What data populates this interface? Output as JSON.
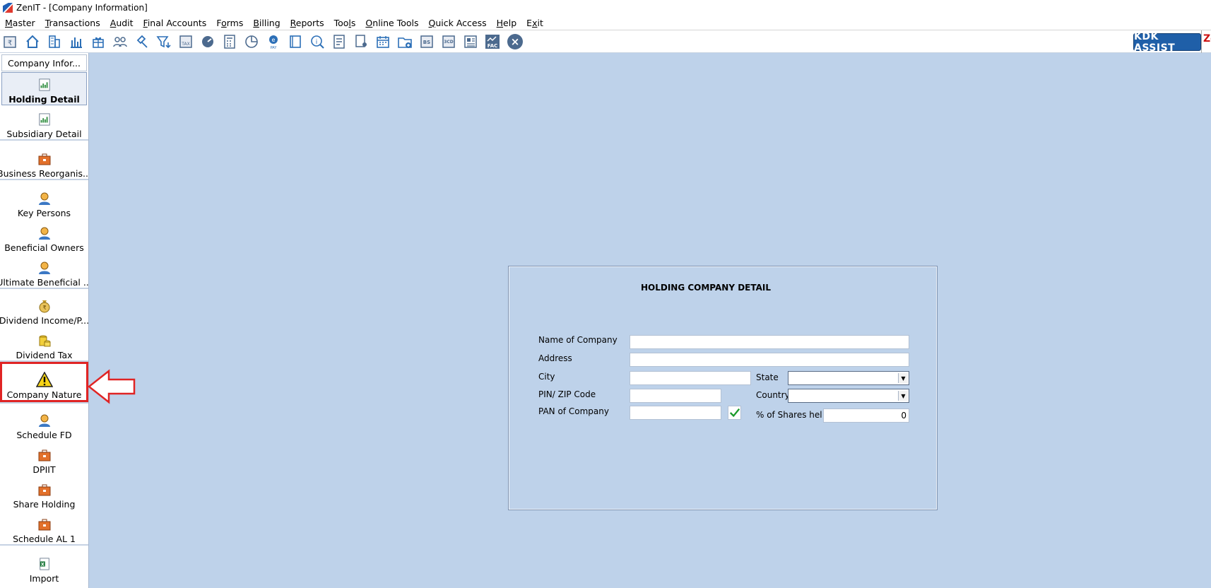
{
  "window": {
    "title": "ZenIT - [Company Information]"
  },
  "menu": {
    "items": [
      {
        "label": "Master",
        "mnemonic": "M",
        "rest": "aster"
      },
      {
        "label": "Transactions",
        "mnemonic": "T",
        "rest": "ransactions"
      },
      {
        "label": "Audit",
        "mnemonic": "A",
        "rest": "udit"
      },
      {
        "label": "Final Accounts",
        "mnemonic": "F",
        "rest": "inal Accounts"
      },
      {
        "label": "Forms",
        "mnemonic": "o",
        "pre": "F",
        "rest": "rms"
      },
      {
        "label": "Billing",
        "mnemonic": "B",
        "rest": "illing"
      },
      {
        "label": "Reports",
        "mnemonic": "R",
        "rest": "eports"
      },
      {
        "label": "Tools",
        "mnemonic": "l",
        "pre": "Too",
        "rest": "s"
      },
      {
        "label": "Online Tools",
        "mnemonic": "O",
        "rest": "nline Tools"
      },
      {
        "label": "Quick Access",
        "mnemonic": "Q",
        "rest": "uick Access"
      },
      {
        "label": "Help",
        "mnemonic": "H",
        "rest": "elp"
      },
      {
        "label": "Exit",
        "mnemonic": "x",
        "pre": "E",
        "rest": "it"
      }
    ]
  },
  "toolbar": {
    "icons": [
      "rupee-book-icon",
      "home-icon",
      "building-icon",
      "bar-chart-icon",
      "gift-icon",
      "group-icon",
      "gavel-icon",
      "filter-icon",
      "tax-calculator-icon",
      "speedometer-icon",
      "calculator-icon",
      "pie-chart-icon",
      "epay-icon",
      "ledger-book-icon",
      "info-search-icon",
      "report-sheet-icon",
      "user-document-icon",
      "calendar-icon",
      "folder-add-icon",
      "bs-icon",
      "3cd-icon",
      "newspaper-icon",
      "fac-icon"
    ],
    "kdk_assist_label": "KDK ASSIST",
    "edge_text": "Ze"
  },
  "sidebar": {
    "header": "Company Infor...",
    "items": [
      {
        "label": "Holding Detail",
        "icon": "report-icon"
      },
      {
        "label": "Subsidiary Detail",
        "icon": "report-icon"
      },
      {
        "label": "Business Reorganis...",
        "icon": "briefcase-icon"
      },
      {
        "label": "Key Persons",
        "icon": "person-icon"
      },
      {
        "label": "Beneficial Owners",
        "icon": "person-icon"
      },
      {
        "label": "Ultimate Beneficial ...",
        "icon": "person-icon"
      },
      {
        "label": "Dividend Income/P...",
        "icon": "money-bag-icon"
      },
      {
        "label": "Dividend Tax",
        "icon": "coins-icon"
      },
      {
        "label": "Company Nature",
        "icon": "warning-icon"
      },
      {
        "label": "Schedule FD",
        "icon": "person-icon"
      },
      {
        "label": "DPIIT",
        "icon": "briefcase-icon"
      },
      {
        "label": "Share Holding",
        "icon": "briefcase-icon"
      },
      {
        "label": "Schedule AL 1",
        "icon": "briefcase-icon"
      },
      {
        "label": "Import",
        "icon": "excel-icon"
      }
    ]
  },
  "form": {
    "title": "HOLDING COMPANY DETAIL",
    "name_label": "Name of Company",
    "name_value": "",
    "address_label": "Address",
    "address_value": "",
    "city_label": "City",
    "city_value": "",
    "state_label": "State",
    "state_value": "",
    "pin_label": "PIN/ ZIP Code",
    "pin_value": "",
    "country_label": "Country",
    "country_value": "",
    "pan_label": "PAN of Company",
    "pan_value": "",
    "shares_label": "% of Shares hel",
    "shares_value": "0"
  },
  "colors": {
    "canvas": "#bed2ea",
    "highlight": "#e02424",
    "kdk": "#1f5fa8"
  }
}
